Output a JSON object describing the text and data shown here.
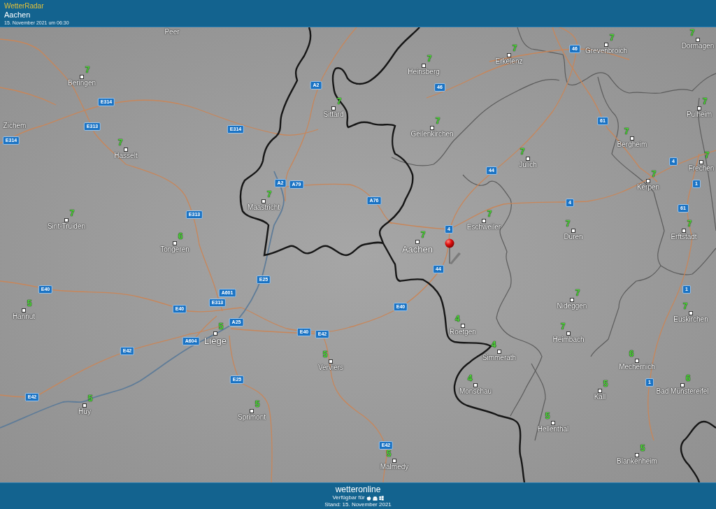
{
  "header": {
    "app_title": "WetterRadar",
    "location": "Aachen",
    "timestamp": "15. November 2021 um 06:30"
  },
  "map": {
    "cities": [
      {
        "name": "Peer",
        "kind": "label_only"
      },
      {
        "name": "Dormagen",
        "value": "7",
        "kind": "town"
      },
      {
        "name": "Grevenbroich",
        "value": "7",
        "kind": "town"
      },
      {
        "name": "Erkelenz",
        "value": "7",
        "kind": "town"
      },
      {
        "name": "Heinsberg",
        "value": "7",
        "kind": "town"
      },
      {
        "name": "Beringen",
        "value": "7",
        "kind": "town"
      },
      {
        "name": "Sittard",
        "value": "7",
        "kind": "town"
      },
      {
        "name": "Pulheim",
        "value": "7",
        "kind": "town"
      },
      {
        "name": "Zichem",
        "kind": "label_only"
      },
      {
        "name": "Geilenkirchen",
        "value": "7",
        "kind": "town"
      },
      {
        "name": "Bergheim",
        "value": "7",
        "kind": "town"
      },
      {
        "name": "Hasselt",
        "value": "7",
        "kind": "town"
      },
      {
        "name": "Jülich",
        "value": "7",
        "kind": "town"
      },
      {
        "name": "Frechen",
        "value": "7",
        "kind": "town"
      },
      {
        "name": "Kerpen",
        "value": "7",
        "kind": "town"
      },
      {
        "name": "Maastricht",
        "value": "7",
        "kind": "town"
      },
      {
        "name": "Sint-Truiden",
        "value": "7",
        "kind": "town"
      },
      {
        "name": "Eschweiler",
        "value": "7",
        "kind": "town"
      },
      {
        "name": "Düren",
        "value": "7",
        "kind": "town"
      },
      {
        "name": "Erftstadt",
        "value": "7",
        "kind": "town"
      },
      {
        "name": "Tongeren",
        "value": "6",
        "kind": "town"
      },
      {
        "name": "Aachen",
        "value": "7",
        "kind": "major"
      },
      {
        "name": "Nideggen",
        "value": "7",
        "kind": "town"
      },
      {
        "name": "Hannut",
        "value": "5",
        "kind": "town"
      },
      {
        "name": "Euskirchen",
        "value": "7",
        "kind": "town"
      },
      {
        "name": "Roetgen",
        "value": "4",
        "kind": "town"
      },
      {
        "name": "Liège",
        "value": "5",
        "kind": "major"
      },
      {
        "name": "Heimbach",
        "value": "7",
        "kind": "town"
      },
      {
        "name": "Simmerath",
        "value": "4",
        "kind": "town"
      },
      {
        "name": "Verviers",
        "value": "5",
        "kind": "town"
      },
      {
        "name": "Mechernich",
        "value": "6",
        "kind": "town"
      },
      {
        "name": "Monschau",
        "value": "4",
        "kind": "town"
      },
      {
        "name": "Kall",
        "value": "5",
        "kind": "town"
      },
      {
        "name": "Bad Münstereifel",
        "value": "6",
        "kind": "town"
      },
      {
        "name": "Huy",
        "value": "5",
        "kind": "town"
      },
      {
        "name": "Sprimont",
        "value": "5",
        "kind": "town"
      },
      {
        "name": "Hellenthal",
        "value": "5",
        "kind": "town"
      },
      {
        "name": "Malmedy",
        "value": "5",
        "kind": "town"
      },
      {
        "name": "Blankenheim",
        "value": "5",
        "kind": "town"
      }
    ],
    "road_signs": [
      "46",
      "A2",
      "46",
      "E314",
      "E313",
      "E314",
      "61",
      "E314",
      "4",
      "44",
      "A2",
      "A79",
      "1",
      "A76",
      "4",
      "61",
      "E313",
      "4",
      "44",
      "E25",
      "E40",
      "A601",
      "1",
      "E40",
      "E313",
      "E40",
      "A25",
      "E40",
      "E42",
      "A604",
      "E42",
      "E25",
      "1",
      "E42",
      "E42"
    ]
  },
  "footer": {
    "logo": "wetteronline",
    "availability": "Verfügbar für",
    "stand": "Stand: 15. November 2021"
  }
}
